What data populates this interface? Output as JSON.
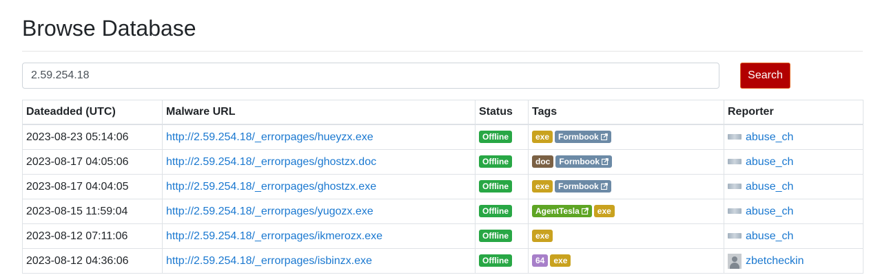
{
  "page": {
    "title": "Browse Database"
  },
  "search": {
    "value": "2.59.254.18",
    "button_label": "Search"
  },
  "table": {
    "headers": [
      "Dateadded (UTC)",
      "Malware URL",
      "Status",
      "Tags",
      "Reporter"
    ],
    "rows": [
      {
        "date": "2023-08-23 05:14:06",
        "url": "http://2.59.254.18/_errorpages/hueyzx.exe",
        "status": "Offline",
        "tags": [
          {
            "label": "exe",
            "style": "exe"
          },
          {
            "label": "Formbook",
            "style": "formbook",
            "external": true
          }
        ],
        "reporter": "abuse_ch",
        "reporter_icon": "abuse-ch-logo"
      },
      {
        "date": "2023-08-17 04:05:06",
        "url": "http://2.59.254.18/_errorpages/ghostzx.doc",
        "status": "Offline",
        "tags": [
          {
            "label": "doc",
            "style": "doc"
          },
          {
            "label": "Formbook",
            "style": "formbook",
            "external": true
          }
        ],
        "reporter": "abuse_ch",
        "reporter_icon": "abuse-ch-logo"
      },
      {
        "date": "2023-08-17 04:04:05",
        "url": "http://2.59.254.18/_errorpages/ghostzx.exe",
        "status": "Offline",
        "tags": [
          {
            "label": "exe",
            "style": "exe"
          },
          {
            "label": "Formbook",
            "style": "formbook",
            "external": true
          }
        ],
        "reporter": "abuse_ch",
        "reporter_icon": "abuse-ch-logo"
      },
      {
        "date": "2023-08-15 11:59:04",
        "url": "http://2.59.254.18/_errorpages/yugozx.exe",
        "status": "Offline",
        "tags": [
          {
            "label": "AgentTesla",
            "style": "agenttesla",
            "external": true
          },
          {
            "label": "exe",
            "style": "exe"
          }
        ],
        "reporter": "abuse_ch",
        "reporter_icon": "abuse-ch-logo"
      },
      {
        "date": "2023-08-12 07:11:06",
        "url": "http://2.59.254.18/_errorpages/ikmerozx.exe",
        "status": "Offline",
        "tags": [
          {
            "label": "exe",
            "style": "exe"
          }
        ],
        "reporter": "abuse_ch",
        "reporter_icon": "abuse-ch-logo"
      },
      {
        "date": "2023-08-12 04:36:06",
        "url": "http://2.59.254.18/_errorpages/isbinzx.exe",
        "status": "Offline",
        "tags": [
          {
            "label": "64",
            "style": "64"
          },
          {
            "label": "exe",
            "style": "exe"
          }
        ],
        "reporter": "zbetcheckin",
        "reporter_icon": "user-avatar-icon"
      }
    ]
  },
  "colors": {
    "search_button": "#b20000",
    "link": "#1a78d0",
    "offline": "#28a745",
    "exe": "#c9a21f",
    "doc": "#7b6144",
    "formbook": "#6c8aa6",
    "agenttesla": "#5ea524",
    "64": "#a77fc9"
  }
}
